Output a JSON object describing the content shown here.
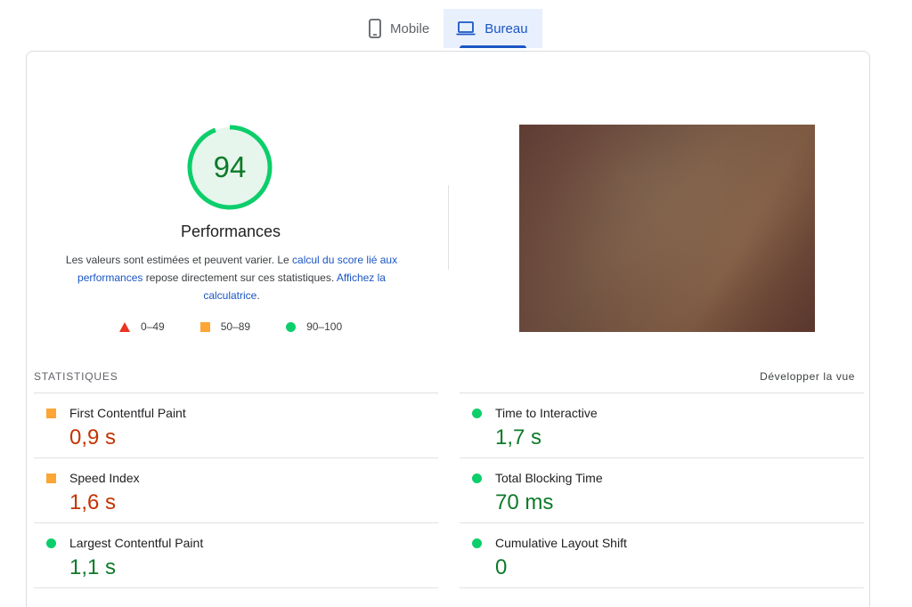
{
  "tabs": [
    {
      "label": "Mobile",
      "icon": "phone-icon",
      "active": false
    },
    {
      "label": "Bureau",
      "icon": "laptop-icon",
      "active": true
    }
  ],
  "score": {
    "value": "94",
    "fraction": 0.94,
    "title": "Performances",
    "color": "#0cce6b"
  },
  "description": {
    "part1": "Les valeurs sont estimées et peuvent varier. Le ",
    "link1": "calcul du score lié aux performances",
    "part2": " repose directement sur ces statistiques. ",
    "link2": "Affichez la calculatrice",
    "part3": "."
  },
  "legend": [
    {
      "range": "0–49",
      "shape": "triangle",
      "color": "#eb3323"
    },
    {
      "range": "50–89",
      "shape": "square",
      "color": "#fda535"
    },
    {
      "range": "90–100",
      "shape": "circle",
      "color": "#0cce6b"
    }
  ],
  "stats": {
    "heading": "STATISTIQUES",
    "expand_label": "Développer la vue"
  },
  "metrics": [
    {
      "label": "First Contentful Paint",
      "value": "0,9 s",
      "rating": "average"
    },
    {
      "label": "Time to Interactive",
      "value": "1,7 s",
      "rating": "good"
    },
    {
      "label": "Speed Index",
      "value": "1,6 s",
      "rating": "average"
    },
    {
      "label": "Total Blocking Time",
      "value": "70 ms",
      "rating": "good"
    },
    {
      "label": "Largest Contentful Paint",
      "value": "1,1 s",
      "rating": "good"
    },
    {
      "label": "Cumulative Layout Shift",
      "value": "0",
      "rating": "good"
    }
  ]
}
